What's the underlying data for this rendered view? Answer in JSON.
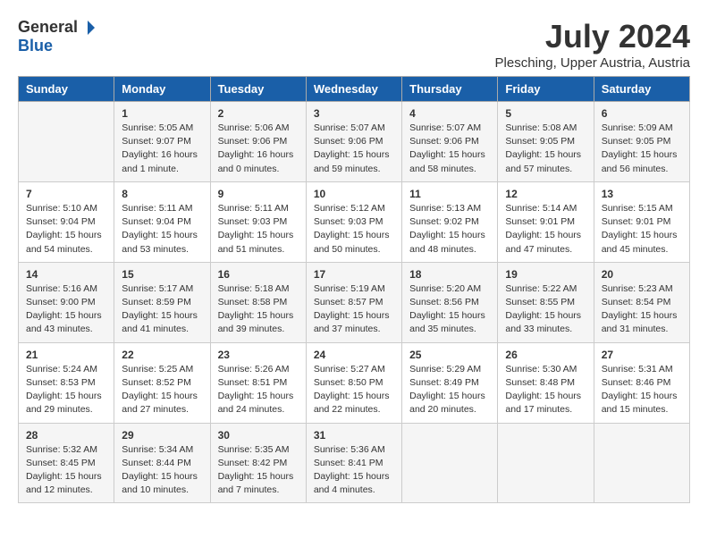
{
  "header": {
    "logo_general": "General",
    "logo_blue": "Blue",
    "title": "July 2024",
    "subtitle": "Plesching, Upper Austria, Austria"
  },
  "columns": [
    "Sunday",
    "Monday",
    "Tuesday",
    "Wednesday",
    "Thursday",
    "Friday",
    "Saturday"
  ],
  "weeks": [
    [
      {
        "num": "",
        "lines": []
      },
      {
        "num": "1",
        "lines": [
          "Sunrise: 5:05 AM",
          "Sunset: 9:07 PM",
          "Daylight: 16 hours",
          "and 1 minute."
        ]
      },
      {
        "num": "2",
        "lines": [
          "Sunrise: 5:06 AM",
          "Sunset: 9:06 PM",
          "Daylight: 16 hours",
          "and 0 minutes."
        ]
      },
      {
        "num": "3",
        "lines": [
          "Sunrise: 5:07 AM",
          "Sunset: 9:06 PM",
          "Daylight: 15 hours",
          "and 59 minutes."
        ]
      },
      {
        "num": "4",
        "lines": [
          "Sunrise: 5:07 AM",
          "Sunset: 9:06 PM",
          "Daylight: 15 hours",
          "and 58 minutes."
        ]
      },
      {
        "num": "5",
        "lines": [
          "Sunrise: 5:08 AM",
          "Sunset: 9:05 PM",
          "Daylight: 15 hours",
          "and 57 minutes."
        ]
      },
      {
        "num": "6",
        "lines": [
          "Sunrise: 5:09 AM",
          "Sunset: 9:05 PM",
          "Daylight: 15 hours",
          "and 56 minutes."
        ]
      }
    ],
    [
      {
        "num": "7",
        "lines": [
          "Sunrise: 5:10 AM",
          "Sunset: 9:04 PM",
          "Daylight: 15 hours",
          "and 54 minutes."
        ]
      },
      {
        "num": "8",
        "lines": [
          "Sunrise: 5:11 AM",
          "Sunset: 9:04 PM",
          "Daylight: 15 hours",
          "and 53 minutes."
        ]
      },
      {
        "num": "9",
        "lines": [
          "Sunrise: 5:11 AM",
          "Sunset: 9:03 PM",
          "Daylight: 15 hours",
          "and 51 minutes."
        ]
      },
      {
        "num": "10",
        "lines": [
          "Sunrise: 5:12 AM",
          "Sunset: 9:03 PM",
          "Daylight: 15 hours",
          "and 50 minutes."
        ]
      },
      {
        "num": "11",
        "lines": [
          "Sunrise: 5:13 AM",
          "Sunset: 9:02 PM",
          "Daylight: 15 hours",
          "and 48 minutes."
        ]
      },
      {
        "num": "12",
        "lines": [
          "Sunrise: 5:14 AM",
          "Sunset: 9:01 PM",
          "Daylight: 15 hours",
          "and 47 minutes."
        ]
      },
      {
        "num": "13",
        "lines": [
          "Sunrise: 5:15 AM",
          "Sunset: 9:01 PM",
          "Daylight: 15 hours",
          "and 45 minutes."
        ]
      }
    ],
    [
      {
        "num": "14",
        "lines": [
          "Sunrise: 5:16 AM",
          "Sunset: 9:00 PM",
          "Daylight: 15 hours",
          "and 43 minutes."
        ]
      },
      {
        "num": "15",
        "lines": [
          "Sunrise: 5:17 AM",
          "Sunset: 8:59 PM",
          "Daylight: 15 hours",
          "and 41 minutes."
        ]
      },
      {
        "num": "16",
        "lines": [
          "Sunrise: 5:18 AM",
          "Sunset: 8:58 PM",
          "Daylight: 15 hours",
          "and 39 minutes."
        ]
      },
      {
        "num": "17",
        "lines": [
          "Sunrise: 5:19 AM",
          "Sunset: 8:57 PM",
          "Daylight: 15 hours",
          "and 37 minutes."
        ]
      },
      {
        "num": "18",
        "lines": [
          "Sunrise: 5:20 AM",
          "Sunset: 8:56 PM",
          "Daylight: 15 hours",
          "and 35 minutes."
        ]
      },
      {
        "num": "19",
        "lines": [
          "Sunrise: 5:22 AM",
          "Sunset: 8:55 PM",
          "Daylight: 15 hours",
          "and 33 minutes."
        ]
      },
      {
        "num": "20",
        "lines": [
          "Sunrise: 5:23 AM",
          "Sunset: 8:54 PM",
          "Daylight: 15 hours",
          "and 31 minutes."
        ]
      }
    ],
    [
      {
        "num": "21",
        "lines": [
          "Sunrise: 5:24 AM",
          "Sunset: 8:53 PM",
          "Daylight: 15 hours",
          "and 29 minutes."
        ]
      },
      {
        "num": "22",
        "lines": [
          "Sunrise: 5:25 AM",
          "Sunset: 8:52 PM",
          "Daylight: 15 hours",
          "and 27 minutes."
        ]
      },
      {
        "num": "23",
        "lines": [
          "Sunrise: 5:26 AM",
          "Sunset: 8:51 PM",
          "Daylight: 15 hours",
          "and 24 minutes."
        ]
      },
      {
        "num": "24",
        "lines": [
          "Sunrise: 5:27 AM",
          "Sunset: 8:50 PM",
          "Daylight: 15 hours",
          "and 22 minutes."
        ]
      },
      {
        "num": "25",
        "lines": [
          "Sunrise: 5:29 AM",
          "Sunset: 8:49 PM",
          "Daylight: 15 hours",
          "and 20 minutes."
        ]
      },
      {
        "num": "26",
        "lines": [
          "Sunrise: 5:30 AM",
          "Sunset: 8:48 PM",
          "Daylight: 15 hours",
          "and 17 minutes."
        ]
      },
      {
        "num": "27",
        "lines": [
          "Sunrise: 5:31 AM",
          "Sunset: 8:46 PM",
          "Daylight: 15 hours",
          "and 15 minutes."
        ]
      }
    ],
    [
      {
        "num": "28",
        "lines": [
          "Sunrise: 5:32 AM",
          "Sunset: 8:45 PM",
          "Daylight: 15 hours",
          "and 12 minutes."
        ]
      },
      {
        "num": "29",
        "lines": [
          "Sunrise: 5:34 AM",
          "Sunset: 8:44 PM",
          "Daylight: 15 hours",
          "and 10 minutes."
        ]
      },
      {
        "num": "30",
        "lines": [
          "Sunrise: 5:35 AM",
          "Sunset: 8:42 PM",
          "Daylight: 15 hours",
          "and 7 minutes."
        ]
      },
      {
        "num": "31",
        "lines": [
          "Sunrise: 5:36 AM",
          "Sunset: 8:41 PM",
          "Daylight: 15 hours",
          "and 4 minutes."
        ]
      },
      {
        "num": "",
        "lines": []
      },
      {
        "num": "",
        "lines": []
      },
      {
        "num": "",
        "lines": []
      }
    ]
  ]
}
